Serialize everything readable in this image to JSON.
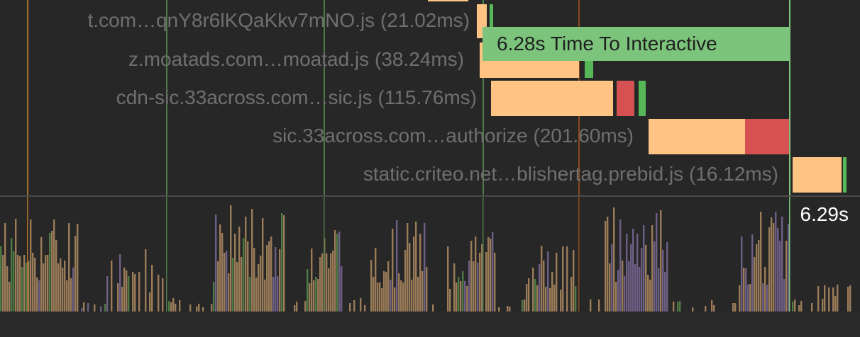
{
  "requests": [
    {
      "label": "t.com…qnY8r6lKQaKkv7mNO.js (21.02ms)"
    },
    {
      "label": "z.moatads.com…moatad.js (38.24ms)"
    },
    {
      "label": "cdn-sic.33across.com…sic.js (115.76ms)"
    },
    {
      "label": "sic.33across.com…authorize (201.60ms)"
    },
    {
      "label": "static.criteo.net…blishertag.prebid.js (16.12ms)"
    }
  ],
  "markers": {
    "time_to_interactive": "6.28s Time To Interactive",
    "end_time": "6.29s"
  },
  "colors": {
    "background": "#272727",
    "download": "#ffc484",
    "execution": "#d65252",
    "parse": "#57b657",
    "tti_flag": "#7cc47c",
    "gridline_orange": "#a86f2e",
    "gridline_green": "#4d7a45",
    "activity_script": "#9b7c58",
    "activity_layout": "#6e5f86",
    "activity_paint": "#4e7a43"
  }
}
